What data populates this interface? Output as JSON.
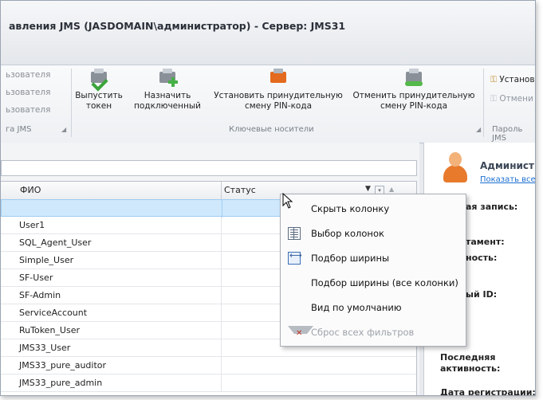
{
  "window": {
    "title": "авления JMS (JASDOMAIN\\администратор) - Сервер: JMS31"
  },
  "ribbon": {
    "left_faded_items": [
      "ьзователя",
      "ьзователя",
      "ьзователя"
    ],
    "left_group_label": "га JMS",
    "buttons": [
      {
        "label_line1": "Выпустить",
        "label_line2": "токен",
        "icon": "token-check-icon"
      },
      {
        "label_line1": "Назначить",
        "label_line2": "подключенный",
        "icon": "token-add-icon"
      },
      {
        "label_line1": "Установить принудительную",
        "label_line2": "смену PIN-кода",
        "icon": "token-pin-set-icon"
      },
      {
        "label_line1": "Отменить принудительную",
        "label_line2": "смену PIN-кода",
        "icon": "token-pin-cancel-icon"
      }
    ],
    "key_group_label": "Ключевые носители",
    "right_items": [
      {
        "label": "Установ",
        "faded": false
      },
      {
        "label": "Отмени",
        "faded": true
      }
    ],
    "right_group_label": "Пароль JMS"
  },
  "grid": {
    "columns": [
      "ФИО",
      "Статус"
    ],
    "sort_indicator": "▼",
    "rows": [
      {
        "name": ""
      },
      {
        "name": "User1"
      },
      {
        "name": "SQL_Agent_User"
      },
      {
        "name": "Simple_User"
      },
      {
        "name": "SF-User"
      },
      {
        "name": "SF-Admin"
      },
      {
        "name": "ServiceAccount"
      },
      {
        "name": "RuToken_User"
      },
      {
        "name": "JMS33_User"
      },
      {
        "name": "JMS33_pure_auditor"
      },
      {
        "name": "JMS33_pure_admin"
      }
    ]
  },
  "details": {
    "name": "Администра",
    "show_all_link": "Показать все а",
    "labels": [
      "ая запись:",
      "тамент:",
      "ность:",
      "ый ID:",
      "Последняя активность:",
      "Дата регистрации:"
    ]
  },
  "context_menu": {
    "items": [
      {
        "label": "Скрыть колонку",
        "icon": "",
        "disabled": false
      },
      {
        "label": "Выбор колонок",
        "icon": "column-chooser-icon",
        "disabled": false
      },
      {
        "label": "Подбор ширины",
        "icon": "best-fit-icon",
        "disabled": false
      },
      {
        "label": "Подбор ширины (все колонки)",
        "icon": "",
        "disabled": false
      },
      {
        "label": "Вид по умолчанию",
        "icon": "",
        "disabled": false
      },
      {
        "label": "Сброс всех фильтров",
        "icon": "clear-filter-icon",
        "disabled": true
      }
    ]
  },
  "colors": {
    "selected_row": "#cfe8fc",
    "link": "#1e6fd0",
    "accent_orange": "#e36a1e",
    "accent_green": "#3aa53a"
  }
}
